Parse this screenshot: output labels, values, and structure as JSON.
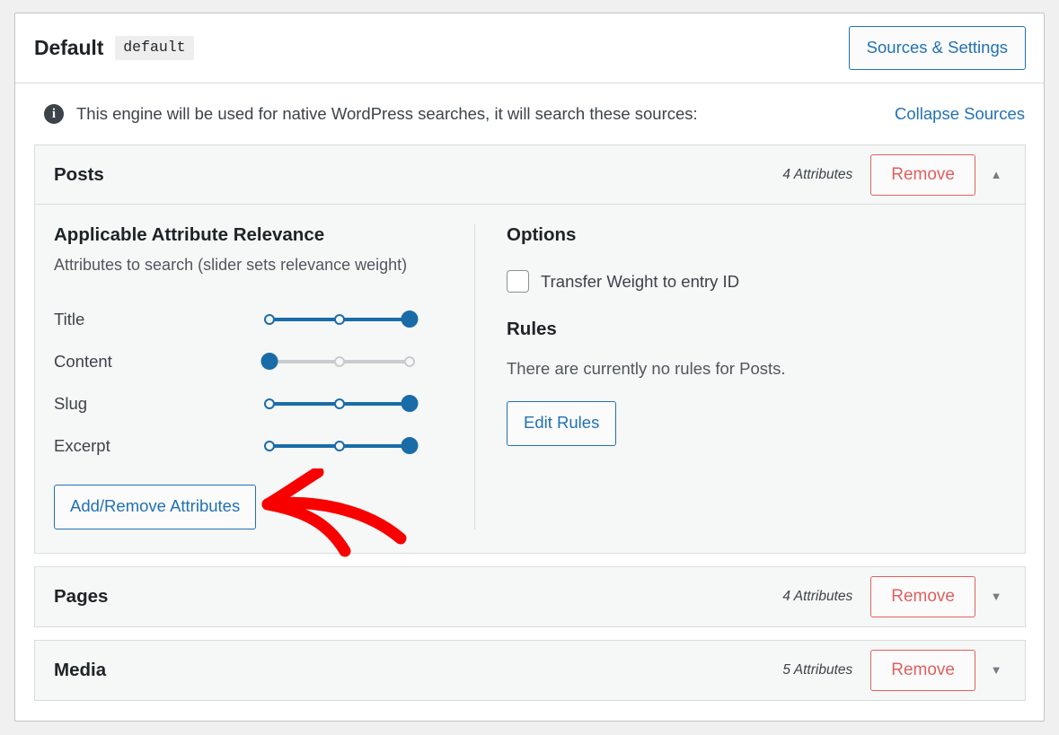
{
  "engine": {
    "title": "Default",
    "slug": "default",
    "sources_settings_button": "Sources & Settings"
  },
  "notice": {
    "icon": "info-icon",
    "text": "This engine will be used for native WordPress searches, it will search these sources:",
    "collapse_link": "Collapse Sources"
  },
  "posts_panel": {
    "name": "Posts",
    "attributes_count": "4 Attributes",
    "remove_label": "Remove",
    "chevron": "▲",
    "relevance": {
      "title": "Applicable Attribute Relevance",
      "subtitle": "Attributes to search (slider sets relevance weight)",
      "add_remove_button": "Add/Remove Attributes",
      "sliders": [
        {
          "label": "Title",
          "value": 3,
          "max": 3
        },
        {
          "label": "Content",
          "value": 1,
          "max": 3
        },
        {
          "label": "Slug",
          "value": 3,
          "max": 3
        },
        {
          "label": "Excerpt",
          "value": 3,
          "max": 3
        }
      ]
    },
    "options": {
      "title": "Options",
      "transfer_weight_label": "Transfer Weight to entry ID",
      "transfer_weight_checked": false,
      "rules_title": "Rules",
      "rules_text": "There are currently no rules for Posts.",
      "edit_rules_button": "Edit Rules"
    }
  },
  "collapsed_panels": [
    {
      "name": "Pages",
      "attributes_count": "4 Attributes",
      "remove_label": "Remove",
      "chevron": "▼"
    },
    {
      "name": "Media",
      "attributes_count": "5 Attributes",
      "remove_label": "Remove",
      "chevron": "▼"
    }
  ],
  "annotation": {
    "type": "hand-drawn-arrow",
    "color": "#f80000",
    "points_to": "Add/Remove Attributes"
  },
  "colors": {
    "accent_blue": "#2271b1",
    "slider_blue": "#1a6ca8",
    "remove_red": "#e0605f",
    "annotation_red": "#f80000",
    "page_background": "#f0f0f1",
    "panel_background": "#f6f7f7"
  }
}
